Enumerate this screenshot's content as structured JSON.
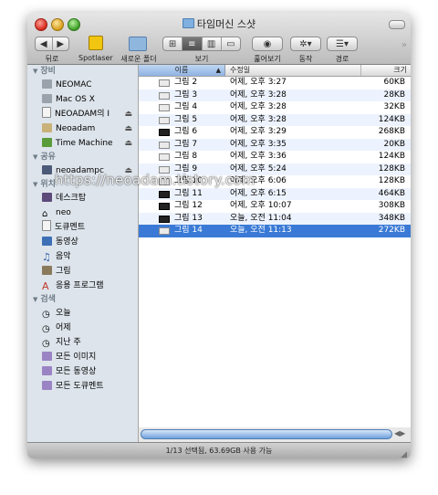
{
  "window": {
    "title": "타임머신 스샷"
  },
  "toolbar": {
    "back_label": "뒤로",
    "spotlaser_label": "Spotlaser",
    "new_folder_label": "새로운 폴더",
    "view_label": "보기",
    "quicklook_label": "훑어보기",
    "action_label": "동작",
    "path_label": "경로"
  },
  "sidebar": {
    "devices_header": "장비",
    "devices": [
      {
        "label": "NEOMAC",
        "icon": "hard-drive-icon"
      },
      {
        "label": "Mac OS X",
        "icon": "hard-drive-icon"
      },
      {
        "label": "NEOADAM의 I",
        "icon": "ipod-icon",
        "eject": true
      },
      {
        "label": "Neoadam",
        "icon": "disk-image-icon",
        "eject": true
      },
      {
        "label": "Time Machine",
        "icon": "time-machine-icon",
        "eject": true
      }
    ],
    "shared_header": "공유",
    "shared": [
      {
        "label": "neoadampc",
        "icon": "network-computer-icon",
        "eject": true
      }
    ],
    "places_header": "위치",
    "places": [
      {
        "label": "데스크탑",
        "icon": "desktop-icon"
      },
      {
        "label": "neo",
        "icon": "home-icon"
      },
      {
        "label": "도큐멘트",
        "icon": "documents-icon"
      },
      {
        "label": "동영상",
        "icon": "movies-icon"
      },
      {
        "label": "음악",
        "icon": "music-icon"
      },
      {
        "label": "그림",
        "icon": "pictures-icon"
      },
      {
        "label": "응용 프로그램",
        "icon": "applications-icon"
      }
    ],
    "search_header": "검색",
    "search": [
      {
        "label": "오늘",
        "icon": "clock-icon"
      },
      {
        "label": "어제",
        "icon": "clock-icon"
      },
      {
        "label": "지난 주",
        "icon": "clock-icon"
      },
      {
        "label": "모든 이미지",
        "icon": "smart-folder-icon"
      },
      {
        "label": "모든 동영상",
        "icon": "smart-folder-icon"
      },
      {
        "label": "모든 도큐멘트",
        "icon": "smart-folder-icon"
      }
    ]
  },
  "columns": {
    "name": "이름",
    "date": "수정일",
    "size": "크기"
  },
  "files": [
    {
      "name": "그림 2",
      "date": "어제, 오후 3:27",
      "size": "60KB"
    },
    {
      "name": "그림 3",
      "date": "어제, 오후 3:28",
      "size": "28KB"
    },
    {
      "name": "그림 4",
      "date": "어제, 오후 3:28",
      "size": "32KB"
    },
    {
      "name": "그림 5",
      "date": "어제, 오후 3:28",
      "size": "124KB"
    },
    {
      "name": "그림 6",
      "date": "어제, 오후 3:29",
      "size": "268KB"
    },
    {
      "name": "그림 7",
      "date": "어제, 오후 3:35",
      "size": "20KB"
    },
    {
      "name": "그림 8",
      "date": "어제, 오후 3:36",
      "size": "124KB"
    },
    {
      "name": "그림 9",
      "date": "어제, 오후 5:24",
      "size": "128KB"
    },
    {
      "name": "그림 10",
      "date": "어제, 오후 6:06",
      "size": "128KB"
    },
    {
      "name": "그림 11",
      "date": "어제, 오후 6:15",
      "size": "464KB"
    },
    {
      "name": "그림 12",
      "date": "어제, 오후 10:07",
      "size": "308KB"
    },
    {
      "name": "그림 13",
      "date": "오늘, 오전 11:04",
      "size": "348KB"
    },
    {
      "name": "그림 14",
      "date": "오늘, 오전 11:13",
      "size": "272KB"
    }
  ],
  "selected_index": 12,
  "status": {
    "text": "1/13 선택됨, 63.69GB 사용 가능"
  },
  "watermark": "https://neoadam.tistory.com",
  "colors": {
    "selection": "#3a7ad6",
    "sidebar_bg": "#dde4eb",
    "stripe": "#edf3fe"
  }
}
